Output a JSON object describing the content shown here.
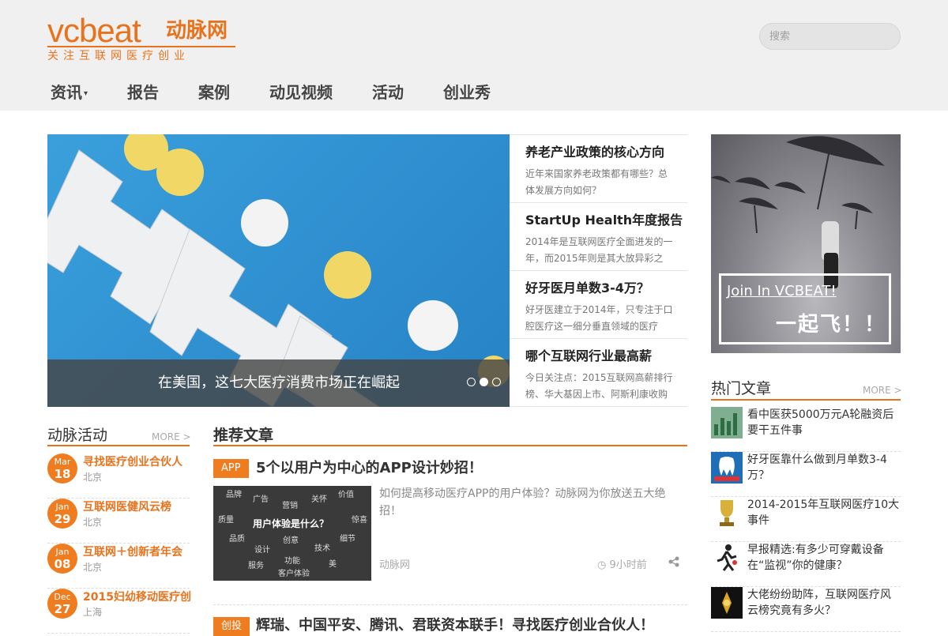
{
  "header": {
    "logo_en": "vcbeat",
    "logo_cn": "动脉网",
    "logo_tagline": "关注互联网医疗创业",
    "search_placeholder": "搜索"
  },
  "nav": [
    {
      "label": "资讯",
      "has_dropdown": true
    },
    {
      "label": "报告"
    },
    {
      "label": "案例"
    },
    {
      "label": "动见视频"
    },
    {
      "label": "活动"
    },
    {
      "label": "创业秀"
    }
  ],
  "slider": {
    "caption": "在美国，这七大医疗消费市场正在崛起",
    "slide_count": 3,
    "active_index": 1
  },
  "side_news": [
    {
      "title": "养老产业政策的核心方向",
      "desc": "近年来国家养老政策都有哪些？总体发展方向如何？"
    },
    {
      "title": "StartUp Health年度报告",
      "desc": "2014年是互联网医疗全面进发的一年，而2015年则是其大放异彩之"
    },
    {
      "title": "好牙医月单数3-4万？",
      "desc": "好牙医建立于2014年，只专注于口腔医疗这一细分垂直领域的医疗"
    },
    {
      "title": "哪个互联网行业最高薪",
      "desc": "今日关注点：2015互联网高薪排行榜、华大基因上市、阿斯利康收购"
    }
  ],
  "ad": {
    "join_text": "Join In VCBEAT!",
    "fly_text": "一起飞！！"
  },
  "hot": {
    "title": "热门文章",
    "more": "MORE >",
    "items": [
      {
        "title": "看中医获5000万元A轮融资后要干五件事",
        "icon": "chart-thumb-icon"
      },
      {
        "title": "好牙医靠什么做到月单数3-4万？",
        "icon": "dental-thumb-icon"
      },
      {
        "title": "2014-2015年互联网医疗10大事件",
        "icon": "trophy-thumb-icon"
      },
      {
        "title": "早报精选:有多少可穿戴设备在“监视”你的健康？",
        "icon": "runner-thumb-icon"
      },
      {
        "title": "大佬纷纷助阵，互联网医疗风云榜究竟有多火？",
        "icon": "award-thumb-icon"
      }
    ]
  },
  "activities": {
    "title": "动脉活动",
    "more": "MORE >",
    "items": [
      {
        "month": "Mar",
        "day": "18",
        "title": "寻找医疗创业合伙人",
        "city": "北京"
      },
      {
        "month": "Jan",
        "day": "29",
        "title": "互联网医健风云榜",
        "city": "北京"
      },
      {
        "month": "Jan",
        "day": "08",
        "title": "互联网＋创新者年会",
        "city": "北京"
      },
      {
        "month": "Dec",
        "day": "27",
        "title": "2015妇幼移动医疗创",
        "city": "上海"
      }
    ]
  },
  "recommended": {
    "title": "推荐文章",
    "articles": [
      {
        "tag": "APP",
        "title": "5个以用户为中心的APP设计妙招！",
        "desc": "如何提高移动医疗APP的用户体验？动脉网为你放送五大绝招！",
        "source": "动脉网",
        "time": "9小时前",
        "thumb_words": [
          "品牌",
          "广告",
          "营销",
          "关怀",
          "价值",
          "质量",
          "用户体验是什么？",
          "惊喜",
          "品质",
          "创意",
          "细节",
          "设计",
          "技术",
          "服务",
          "功能",
          "美",
          "客户体验"
        ]
      },
      {
        "tag": "创投",
        "title": "辉瑞、中国平安、腾讯、君联资本联手！寻找医疗创业合伙人！"
      }
    ]
  },
  "colors": {
    "accent": "#e8731c",
    "header_bg": "#f0f0f0"
  }
}
